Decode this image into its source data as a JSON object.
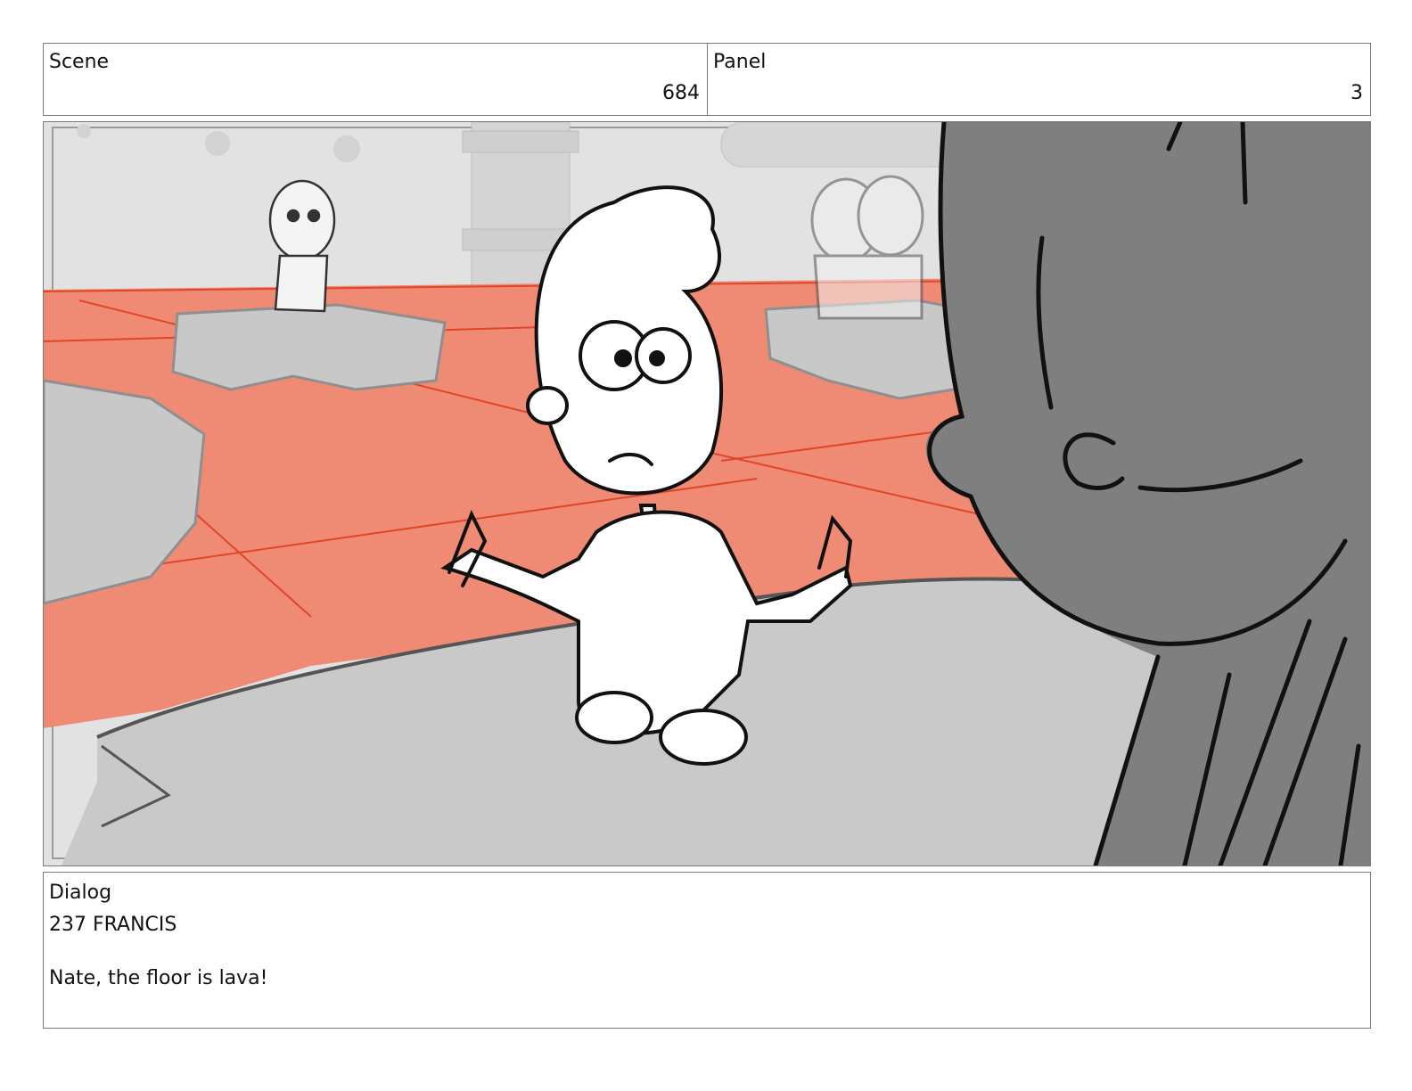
{
  "header": {
    "scene_label": "Scene",
    "scene_number": "684",
    "panel_label": "Panel",
    "panel_number": "3"
  },
  "dialog": {
    "label": "Dialog",
    "speaker": "237 FRANCIS",
    "line": "Nate, the floor is lava!"
  },
  "colors": {
    "lava": "#ef8a74",
    "lava_lines": "#e0452a",
    "floor": "#c9c9c9",
    "wall": "#e2e2e2",
    "foreground_figure": "#7f7f7f"
  }
}
